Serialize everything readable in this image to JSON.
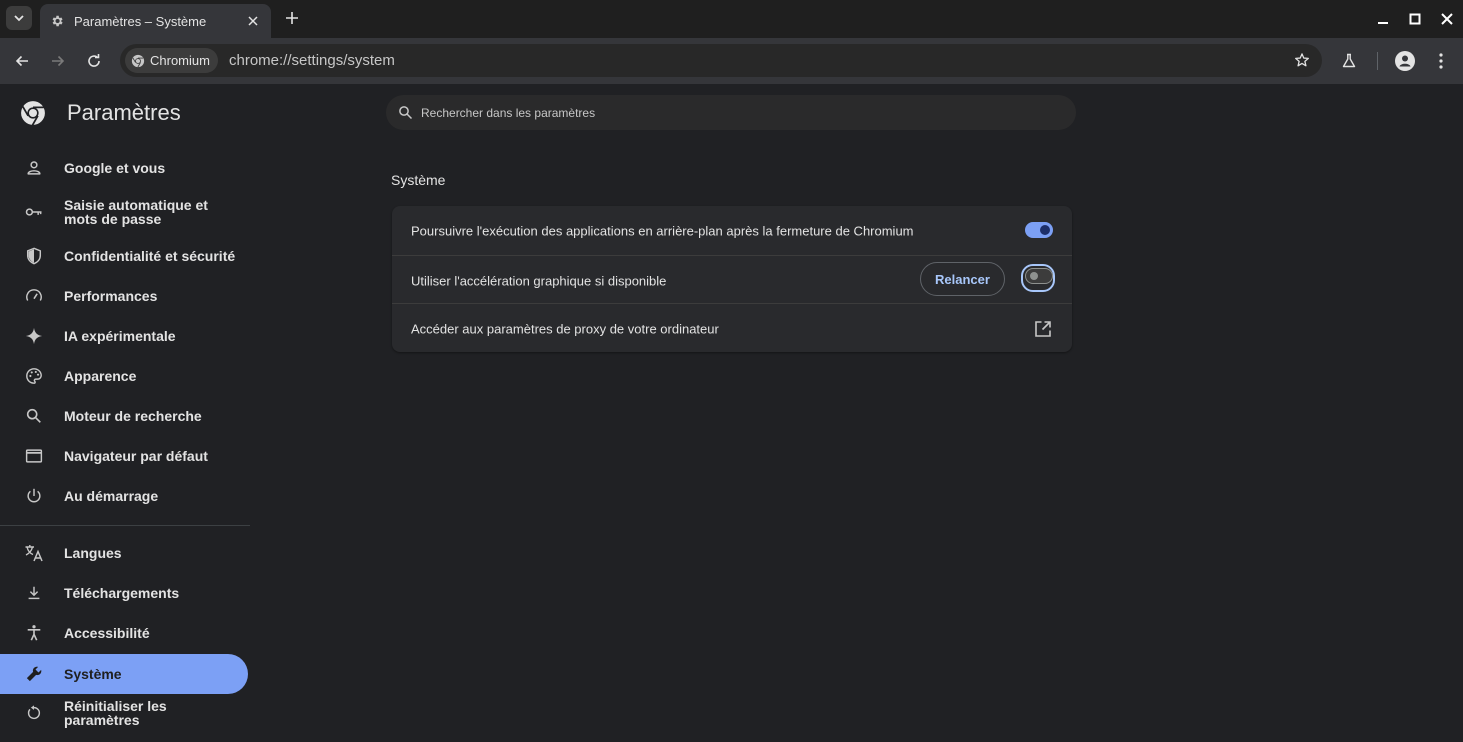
{
  "window": {
    "tab_title": "Paramètres – Système",
    "controls": [
      "minimize",
      "maximize",
      "close"
    ]
  },
  "toolbar": {
    "chip_label": "Chromium",
    "url": "chrome://settings/system"
  },
  "sidebar": {
    "title": "Paramètres",
    "items": [
      {
        "label": "Google et vous",
        "icon": "person-icon"
      },
      {
        "label": "Saisie automatique et mots de passe",
        "icon": "key-icon"
      },
      {
        "label": "Confidentialité et sécurité",
        "icon": "shield-icon"
      },
      {
        "label": "Performances",
        "icon": "speedometer-icon"
      },
      {
        "label": "IA expérimentale",
        "icon": "sparkle-icon"
      },
      {
        "label": "Apparence",
        "icon": "palette-icon"
      },
      {
        "label": "Moteur de recherche",
        "icon": "search-icon"
      },
      {
        "label": "Navigateur par défaut",
        "icon": "browser-window-icon"
      },
      {
        "label": "Au démarrage",
        "icon": "power-icon"
      },
      {
        "label": "Langues",
        "icon": "translate-icon"
      },
      {
        "label": "Téléchargements",
        "icon": "download-icon"
      },
      {
        "label": "Accessibilité",
        "icon": "accessibility-icon"
      },
      {
        "label": "Système",
        "icon": "wrench-icon",
        "active": true
      },
      {
        "label": "Réinitialiser les paramètres",
        "icon": "reset-icon"
      }
    ]
  },
  "main": {
    "search_placeholder": "Rechercher dans les paramètres",
    "section_title": "Système",
    "rows": [
      {
        "label": "Poursuivre l'exécution des applications en arrière-plan après la fermeture de Chromium",
        "toggle": "on"
      },
      {
        "label": "Utiliser l'accélération graphique si disponible",
        "button": "Relancer",
        "toggle": "off"
      },
      {
        "label": "Accéder aux paramètres de proxy de votre ordinateur",
        "icon": "external-link-icon"
      }
    ]
  },
  "colors": {
    "background": "#202124",
    "accent": "#7ca0f5",
    "card": "#292a2d"
  }
}
